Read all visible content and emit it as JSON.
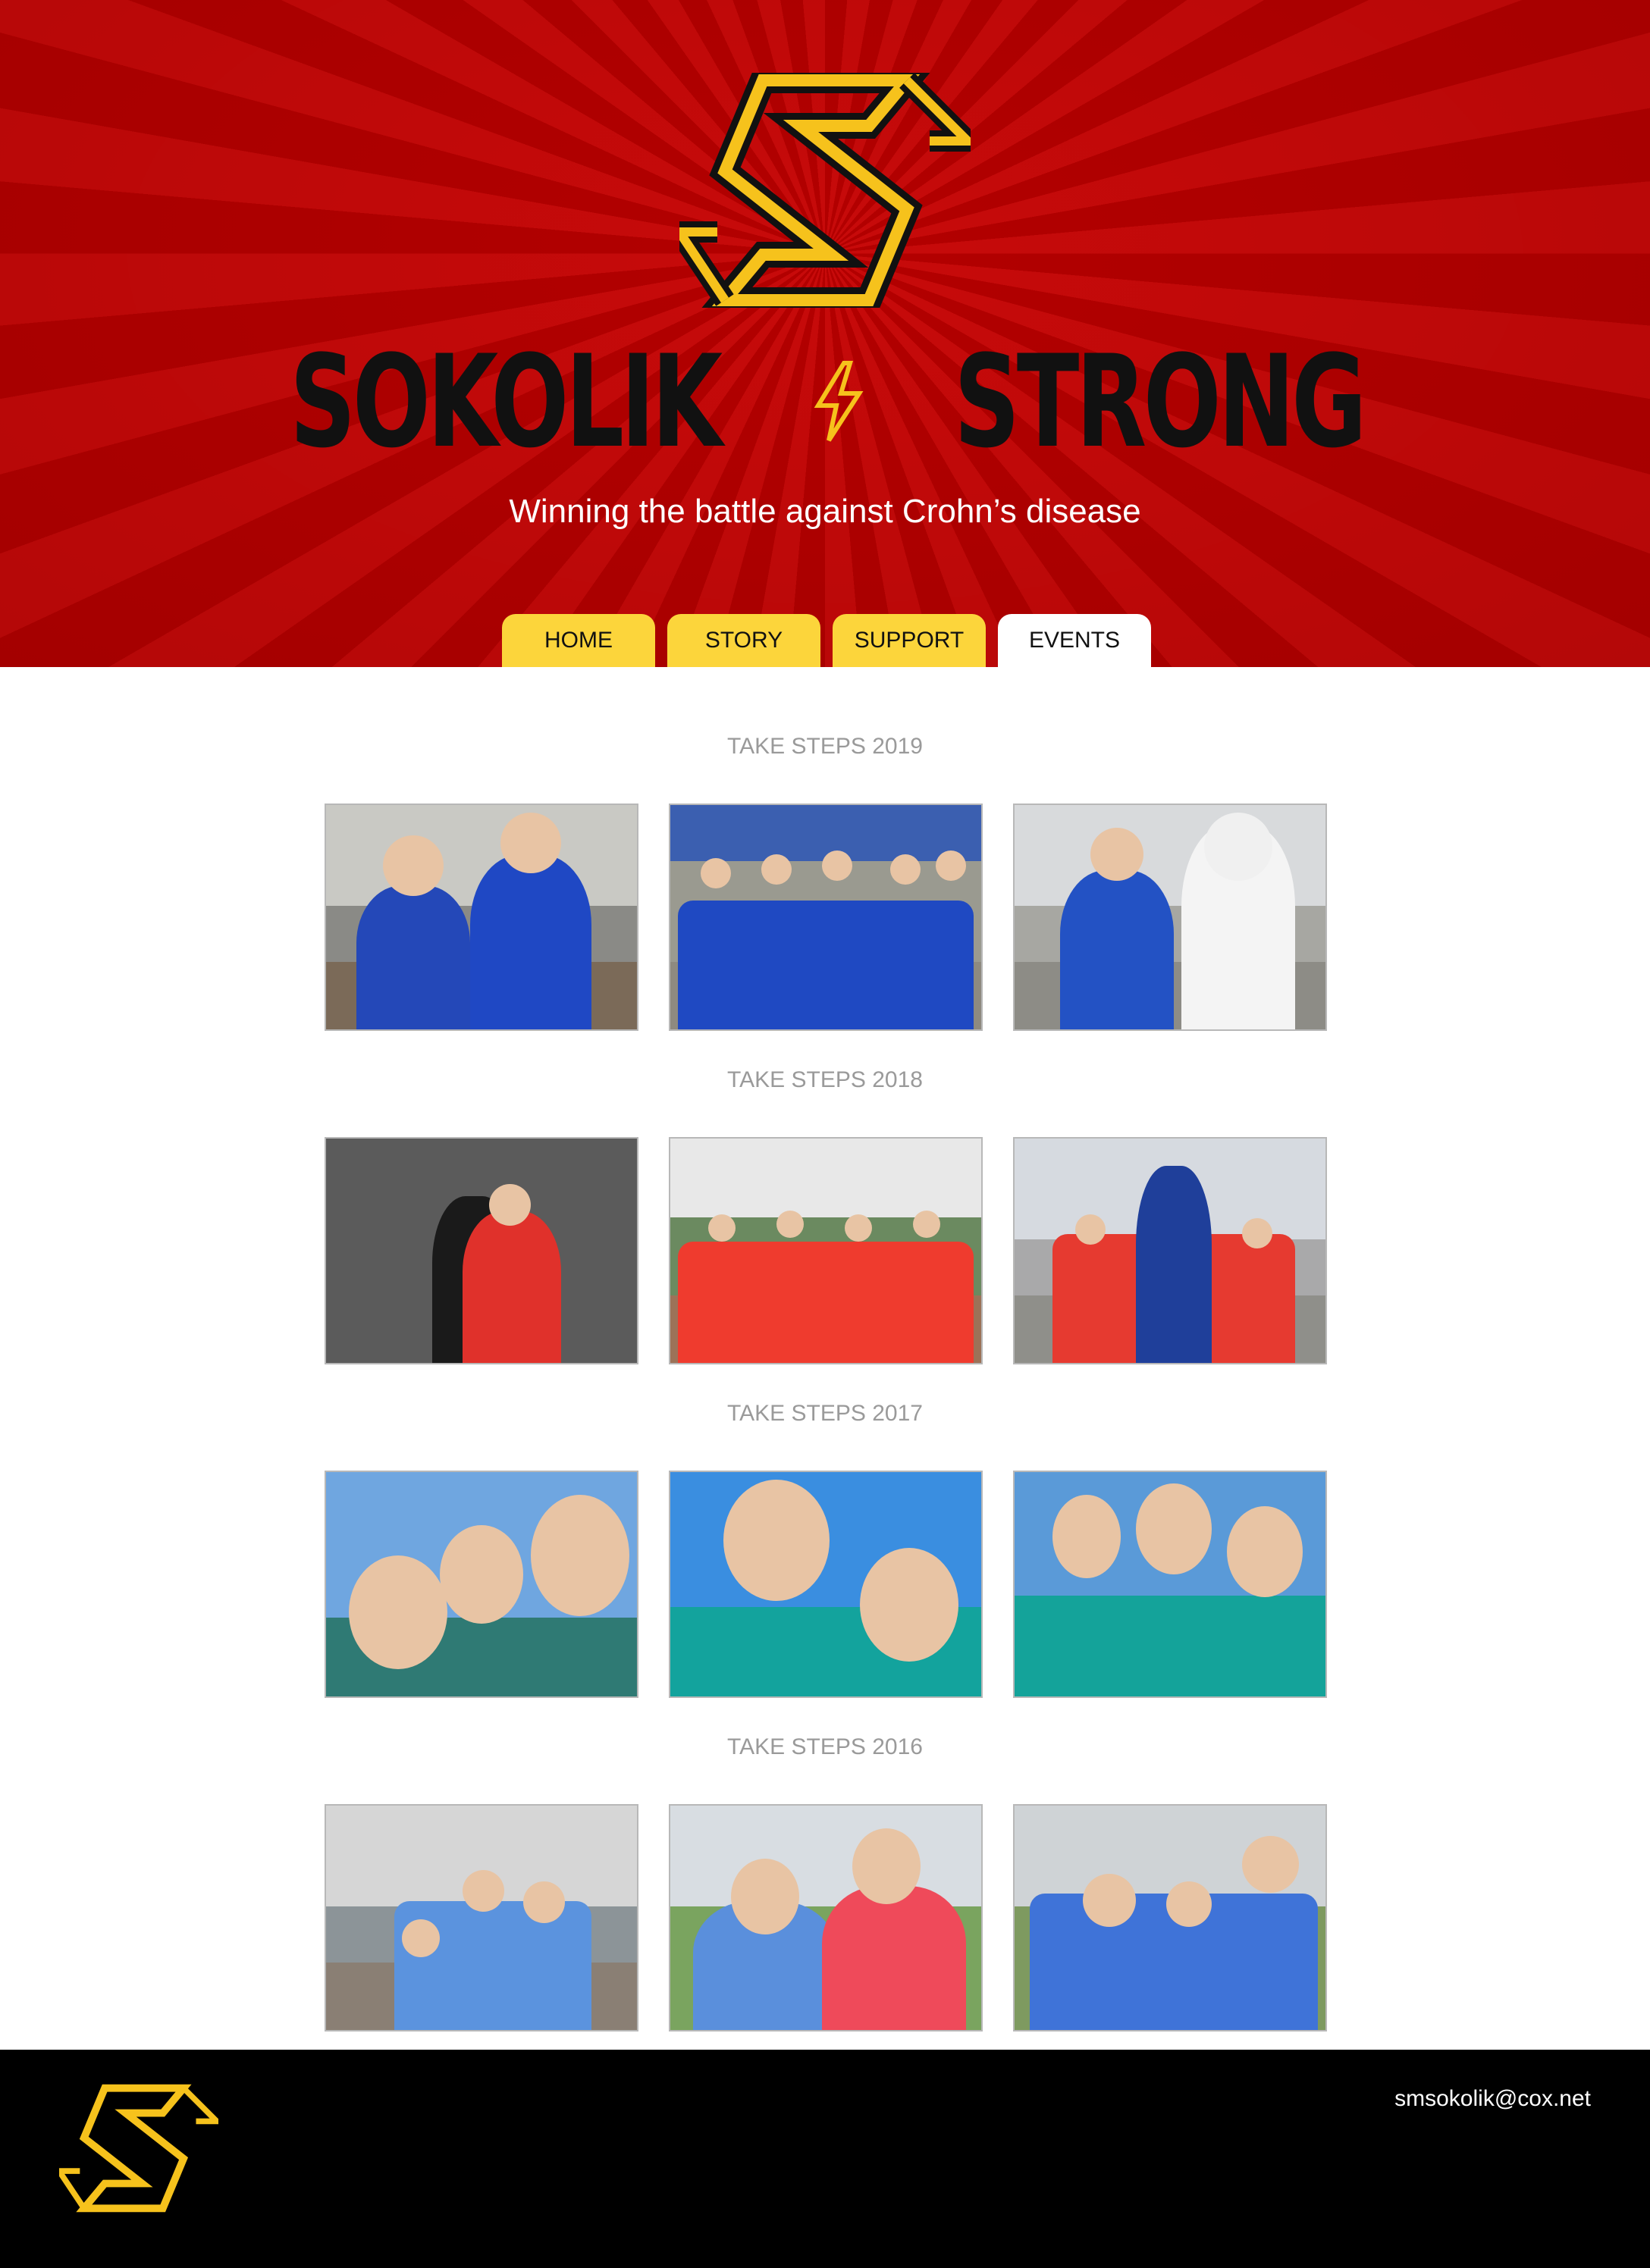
{
  "brand": {
    "name_left": "SOKOLIK",
    "name_right": "STRONG",
    "tagline": "Winning the battle against Crohn’s disease"
  },
  "nav": {
    "items": [
      {
        "label": "HOME",
        "active": false
      },
      {
        "label": "STORY",
        "active": false
      },
      {
        "label": "SUPPORT",
        "active": false
      },
      {
        "label": "EVENTS",
        "active": true
      }
    ]
  },
  "gallery": {
    "sections": [
      {
        "title": "TAKE STEPS 2019",
        "photo_count": 3
      },
      {
        "title": "TAKE STEPS 2018",
        "photo_count": 3
      },
      {
        "title": "TAKE STEPS 2017",
        "photo_count": 3
      },
      {
        "title": "TAKE STEPS 2016",
        "photo_count": 3
      }
    ]
  },
  "footer": {
    "email": "smsokolik@cox.net"
  },
  "colors": {
    "header_red": "#c80a0a",
    "tab_yellow": "#fcd53b",
    "logo_gold": "#f6c21c",
    "footer_black": "#000000"
  },
  "icons": [
    "s-logo-icon",
    "lightning-bolt-icon"
  ]
}
